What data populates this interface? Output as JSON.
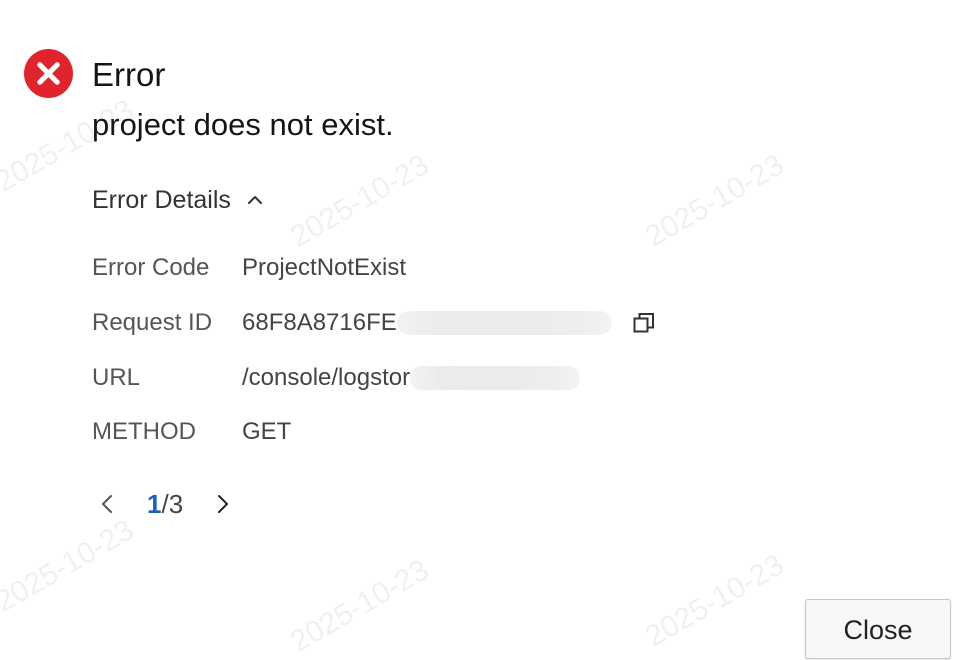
{
  "watermark": {
    "text": "2025-10-23"
  },
  "dialog": {
    "title": "Error",
    "message": "project does not exist.",
    "details_toggle_label": "Error Details",
    "details": {
      "error_code": {
        "label": "Error Code",
        "value": "ProjectNotExist"
      },
      "request_id": {
        "label": "Request ID",
        "value": "68F8A8716FE"
      },
      "url": {
        "label": "URL",
        "value": "/console/logstor"
      },
      "method": {
        "label": "METHOD",
        "value": "GET"
      }
    },
    "pagination": {
      "current": "1",
      "separator": "/",
      "total": "3"
    },
    "close_label": "Close"
  },
  "colors": {
    "error_red": "#e0242b",
    "page_current_blue": "#1565c0"
  },
  "icons": {
    "error": "error-circle-x-icon",
    "toggle": "chevron-up-icon",
    "copy": "copy-icon",
    "prev": "chevron-left-icon",
    "next": "chevron-right-icon"
  }
}
